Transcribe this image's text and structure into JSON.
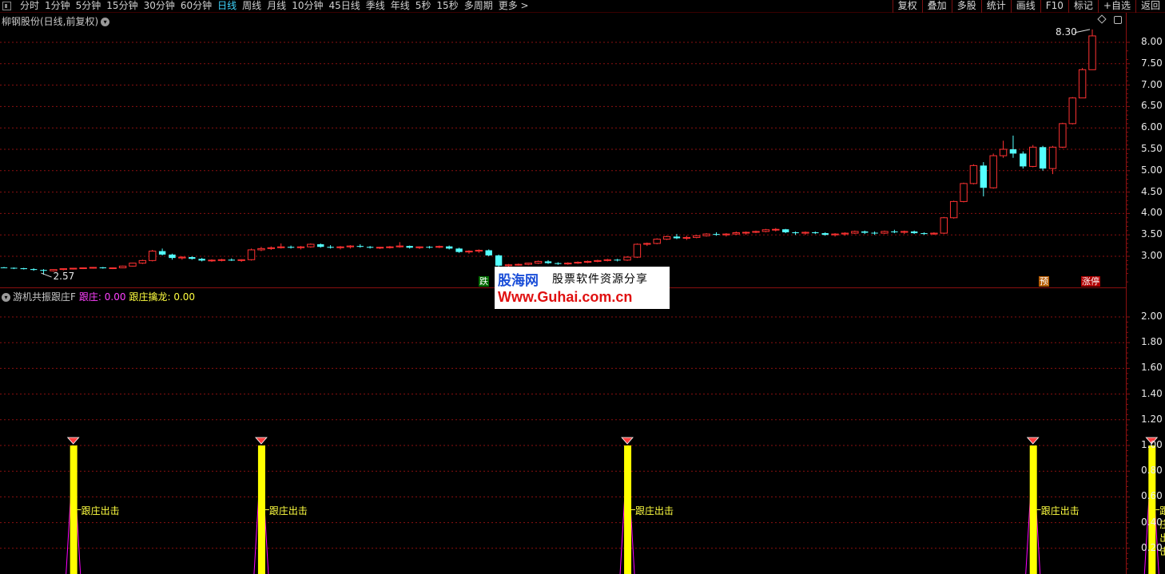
{
  "toolbar": {
    "timeframes": [
      "分时",
      "1分钟",
      "5分钟",
      "15分钟",
      "30分钟",
      "60分钟",
      "日线",
      "周线",
      "月线",
      "10分钟",
      "45日线",
      "季线",
      "年线",
      "5秒",
      "15秒",
      "多周期",
      "更多 >"
    ],
    "active_index": 6,
    "right_buttons": [
      "复权",
      "叠加",
      "多股",
      "统计",
      "画线",
      "F10",
      "标记",
      "+自选",
      "返回"
    ]
  },
  "main_panel": {
    "title": "柳钢股份(日线,前复权)",
    "max_label": "8.30",
    "min_label": "2.57",
    "badges": {
      "fall": "跌",
      "pre": "预",
      "limit_up": "涨停"
    }
  },
  "indicator_panel": {
    "name": "游机共振跟庄F",
    "series1": "跟庄: 0.00",
    "series2": "跟庄擒龙: 0.00",
    "signal_label": "跟庄出击"
  },
  "watermark": {
    "brand": "股海网",
    "slogan": "股票软件资源分享",
    "url": "Www.Guhai.com.cn"
  },
  "colors": {
    "up": "#ff3232",
    "down": "#54ffff",
    "grid": "#8a1010",
    "signal_bar": "#ffff00",
    "signal_line": "#ff00ff"
  },
  "chart_data": [
    {
      "type": "candlestick",
      "title": "柳钢股份(日线,前复权)",
      "y_axis_ticks": [
        "3.00",
        "3.50",
        "4.00",
        "4.50",
        "5.00",
        "5.50",
        "6.00",
        "6.50",
        "7.00",
        "7.50",
        "8.00"
      ],
      "ylim": [
        2.4,
        8.5
      ],
      "annotations": [
        {
          "text": "8.30",
          "at": "max"
        },
        {
          "text": "2.57",
          "at": "min"
        }
      ],
      "candles": [
        [
          2.74,
          2.75,
          2.72,
          2.73
        ],
        [
          2.73,
          2.74,
          2.7,
          2.72
        ],
        [
          2.72,
          2.73,
          2.69,
          2.7
        ],
        [
          2.7,
          2.72,
          2.66,
          2.68
        ],
        [
          2.68,
          2.7,
          2.57,
          2.66
        ],
        [
          2.66,
          2.7,
          2.64,
          2.69
        ],
        [
          2.69,
          2.72,
          2.67,
          2.71
        ],
        [
          2.71,
          2.73,
          2.69,
          2.72
        ],
        [
          2.72,
          2.74,
          2.7,
          2.73
        ],
        [
          2.73,
          2.75,
          2.71,
          2.74
        ],
        [
          2.74,
          2.75,
          2.71,
          2.72
        ],
        [
          2.72,
          2.74,
          2.7,
          2.73
        ],
        [
          2.73,
          2.78,
          2.72,
          2.77
        ],
        [
          2.77,
          2.85,
          2.76,
          2.84
        ],
        [
          2.84,
          2.92,
          2.82,
          2.9
        ],
        [
          2.9,
          3.15,
          2.88,
          3.12
        ],
        [
          3.12,
          3.18,
          3.02,
          3.04
        ],
        [
          3.04,
          3.06,
          2.92,
          2.96
        ],
        [
          2.96,
          3.0,
          2.92,
          2.98
        ],
        [
          2.98,
          3.0,
          2.92,
          2.94
        ],
        [
          2.94,
          2.96,
          2.88,
          2.9
        ],
        [
          2.9,
          2.93,
          2.87,
          2.91
        ],
        [
          2.91,
          2.94,
          2.88,
          2.92
        ],
        [
          2.92,
          2.95,
          2.89,
          2.9
        ],
        [
          2.9,
          2.93,
          2.87,
          2.92
        ],
        [
          2.92,
          3.18,
          2.9,
          3.15
        ],
        [
          3.15,
          3.22,
          3.12,
          3.18
        ],
        [
          3.18,
          3.23,
          3.15,
          3.2
        ],
        [
          3.2,
          3.3,
          3.18,
          3.22
        ],
        [
          3.22,
          3.25,
          3.18,
          3.2
        ],
        [
          3.2,
          3.24,
          3.16,
          3.22
        ],
        [
          3.22,
          3.3,
          3.2,
          3.28
        ],
        [
          3.28,
          3.3,
          3.2,
          3.22
        ],
        [
          3.22,
          3.26,
          3.18,
          3.2
        ],
        [
          3.2,
          3.24,
          3.16,
          3.22
        ],
        [
          3.22,
          3.26,
          3.18,
          3.24
        ],
        [
          3.24,
          3.28,
          3.2,
          3.22
        ],
        [
          3.22,
          3.24,
          3.18,
          3.2
        ],
        [
          3.2,
          3.22,
          3.17,
          3.21
        ],
        [
          3.21,
          3.24,
          3.18,
          3.22
        ],
        [
          3.22,
          3.33,
          3.2,
          3.24
        ],
        [
          3.24,
          3.25,
          3.18,
          3.2
        ],
        [
          3.2,
          3.23,
          3.17,
          3.22
        ],
        [
          3.22,
          3.24,
          3.18,
          3.21
        ],
        [
          3.21,
          3.25,
          3.19,
          3.23
        ],
        [
          3.23,
          3.25,
          3.16,
          3.18
        ],
        [
          3.18,
          3.2,
          3.08,
          3.1
        ],
        [
          3.1,
          3.14,
          3.06,
          3.12
        ],
        [
          3.12,
          3.16,
          3.08,
          3.14
        ],
        [
          3.14,
          3.16,
          3.0,
          3.02
        ],
        [
          3.02,
          3.04,
          2.76,
          2.78
        ],
        [
          2.78,
          2.82,
          2.75,
          2.8
        ],
        [
          2.8,
          2.83,
          2.78,
          2.81
        ],
        [
          2.81,
          2.85,
          2.79,
          2.84
        ],
        [
          2.84,
          2.9,
          2.82,
          2.88
        ],
        [
          2.88,
          2.91,
          2.82,
          2.84
        ],
        [
          2.84,
          2.86,
          2.8,
          2.82
        ],
        [
          2.82,
          2.86,
          2.8,
          2.84
        ],
        [
          2.84,
          2.88,
          2.82,
          2.86
        ],
        [
          2.86,
          2.9,
          2.84,
          2.88
        ],
        [
          2.88,
          2.92,
          2.86,
          2.9
        ],
        [
          2.9,
          2.94,
          2.88,
          2.92
        ],
        [
          2.92,
          2.94,
          2.88,
          2.91
        ],
        [
          2.91,
          3.0,
          2.89,
          2.98
        ],
        [
          2.98,
          3.3,
          2.96,
          3.28
        ],
        [
          3.28,
          3.32,
          3.24,
          3.3
        ],
        [
          3.3,
          3.42,
          3.28,
          3.4
        ],
        [
          3.4,
          3.48,
          3.38,
          3.46
        ],
        [
          3.46,
          3.52,
          3.4,
          3.42
        ],
        [
          3.42,
          3.48,
          3.38,
          3.44
        ],
        [
          3.44,
          3.5,
          3.42,
          3.48
        ],
        [
          3.48,
          3.54,
          3.46,
          3.52
        ],
        [
          3.52,
          3.56,
          3.48,
          3.5
        ],
        [
          3.5,
          3.54,
          3.46,
          3.52
        ],
        [
          3.52,
          3.58,
          3.5,
          3.55
        ],
        [
          3.55,
          3.58,
          3.5,
          3.56
        ],
        [
          3.56,
          3.6,
          3.54,
          3.58
        ],
        [
          3.58,
          3.64,
          3.56,
          3.62
        ],
        [
          3.62,
          3.66,
          3.58,
          3.63
        ],
        [
          3.63,
          3.64,
          3.54,
          3.56
        ],
        [
          3.56,
          3.58,
          3.5,
          3.54
        ],
        [
          3.54,
          3.58,
          3.5,
          3.56
        ],
        [
          3.56,
          3.58,
          3.52,
          3.54
        ],
        [
          3.54,
          3.56,
          3.48,
          3.5
        ],
        [
          3.5,
          3.54,
          3.46,
          3.52
        ],
        [
          3.52,
          3.56,
          3.48,
          3.54
        ],
        [
          3.54,
          3.6,
          3.52,
          3.58
        ],
        [
          3.58,
          3.6,
          3.52,
          3.55
        ],
        [
          3.55,
          3.58,
          3.5,
          3.54
        ],
        [
          3.54,
          3.6,
          3.52,
          3.58
        ],
        [
          3.58,
          3.62,
          3.54,
          3.56
        ],
        [
          3.56,
          3.6,
          3.52,
          3.58
        ],
        [
          3.58,
          3.6,
          3.52,
          3.54
        ],
        [
          3.54,
          3.56,
          3.5,
          3.52
        ],
        [
          3.52,
          3.56,
          3.5,
          3.54
        ],
        [
          3.54,
          3.92,
          3.52,
          3.9
        ],
        [
          3.9,
          4.3,
          3.88,
          4.28
        ],
        [
          4.28,
          4.72,
          4.26,
          4.7
        ],
        [
          4.7,
          5.15,
          4.68,
          5.12
        ],
        [
          5.12,
          5.2,
          4.4,
          4.6
        ],
        [
          4.6,
          5.4,
          4.58,
          5.35
        ],
        [
          5.35,
          5.7,
          5.3,
          5.5
        ],
        [
          5.5,
          5.82,
          5.3,
          5.4
        ],
        [
          5.4,
          5.45,
          5.05,
          5.1
        ],
        [
          5.1,
          5.6,
          5.08,
          5.55
        ],
        [
          5.55,
          5.58,
          5.0,
          5.05
        ],
        [
          5.05,
          5.58,
          4.92,
          5.55
        ],
        [
          5.55,
          6.12,
          5.53,
          6.1
        ],
        [
          6.1,
          6.72,
          6.08,
          6.7
        ],
        [
          6.7,
          7.4,
          6.9,
          7.36
        ],
        [
          7.36,
          8.3,
          7.4,
          8.15
        ]
      ]
    },
    {
      "type": "bar",
      "title": "游机共振跟庄F",
      "y_axis_ticks": [
        "0.20",
        "0.40",
        "0.60",
        "0.80",
        "1.00",
        "1.20",
        "1.40",
        "1.60",
        "1.80",
        "2.00"
      ],
      "ylim": [
        0,
        2.2
      ],
      "series": [
        {
          "name": "跟庄",
          "signal_indices": [
            7,
            26,
            63,
            104,
            116
          ],
          "value": 1.0
        },
        {
          "name": "跟庄擒龙",
          "value": 0.0
        }
      ],
      "signal_text": "跟庄出击"
    }
  ]
}
